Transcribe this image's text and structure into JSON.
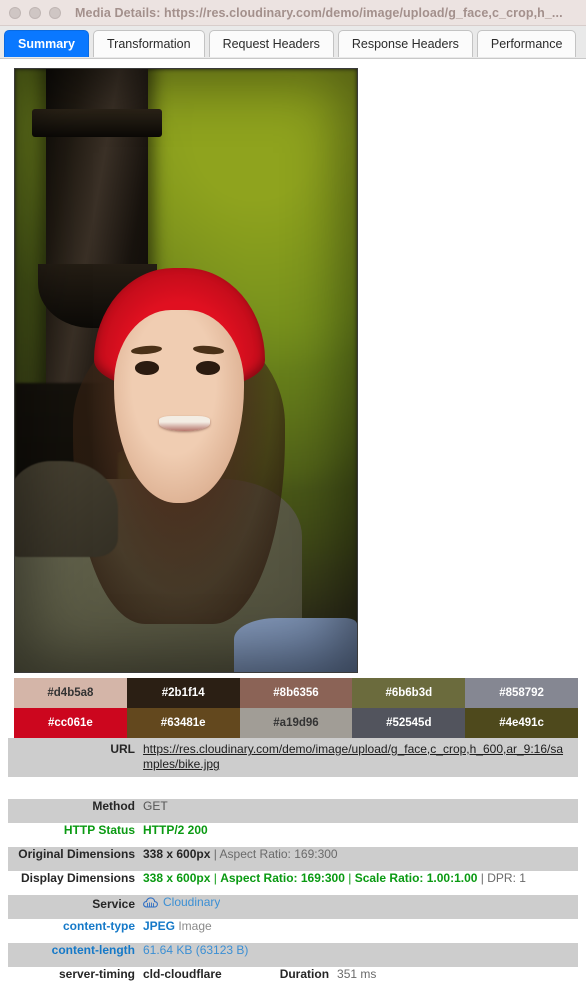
{
  "window": {
    "title": "Media Details: https://res.cloudinary.com/demo/image/upload/g_face,c_crop,h_...",
    "controls": [
      "close",
      "minimize",
      "maximize"
    ]
  },
  "tabs": [
    {
      "label": "Summary",
      "active": true
    },
    {
      "label": "Transformation",
      "active": false
    },
    {
      "label": "Request Headers",
      "active": false
    },
    {
      "label": "Response Headers",
      "active": false
    },
    {
      "label": "Performance",
      "active": false
    }
  ],
  "preview": {
    "alt": "Cropped photo of a smiling young woman wearing a red knit hat, olive jacket, blurred green foliage background"
  },
  "palette": [
    [
      {
        "hex": "#d4b5a8",
        "text": "#d4b5a8",
        "fg": "#333333"
      },
      {
        "hex": "#2b1f14",
        "text": "#2b1f14",
        "fg": "#ffffff"
      },
      {
        "hex": "#8b6356",
        "text": "#8b6356",
        "fg": "#ffffff"
      },
      {
        "hex": "#6b6b3d",
        "text": "#6b6b3d",
        "fg": "#ffffff"
      },
      {
        "hex": "#858792",
        "text": "#858792",
        "fg": "#ffffff"
      }
    ],
    [
      {
        "hex": "#cc061e",
        "text": "#cc061e",
        "fg": "#ffffff"
      },
      {
        "hex": "#63481e",
        "text": "#63481e",
        "fg": "#ffffff"
      },
      {
        "hex": "#a19d96",
        "text": "#a19d96",
        "fg": "#333333"
      },
      {
        "hex": "#52545d",
        "text": "#52545d",
        "fg": "#ffffff"
      },
      {
        "hex": "#4e491c",
        "text": "#4e491c",
        "fg": "#ffffff"
      }
    ]
  ],
  "url": {
    "label": "URL",
    "value": "https://res.cloudinary.com/demo/image/upload/g_face,c_crop,h_600,ar_9:16/samples/bike.jpg"
  },
  "info": {
    "method": {
      "label": "Method",
      "value": "GET"
    },
    "http_status": {
      "label": "HTTP Status",
      "value": "HTTP/2 200"
    },
    "original_dimensions": {
      "label": "Original Dimensions",
      "size": "338 x 600px",
      "sep1": " | ",
      "aspect": "Aspect Ratio: 169:300"
    },
    "display_dimensions": {
      "label": "Display Dimensions",
      "size": "338 x 600px",
      "sep1": " | ",
      "aspect": "Aspect Ratio: 169:300",
      "sep2": " | ",
      "scale": "Scale Ratio: 1.00:1.00",
      "sep3": " | ",
      "dpr": "DPR: 1"
    },
    "service": {
      "label": "Service",
      "value": "Cloudinary",
      "icon": "cloud-icon"
    },
    "content_type": {
      "label": "content-type",
      "format": "JPEG",
      "kind": " Image"
    },
    "content_length": {
      "label": "content-length",
      "value": "61.64 KB (63123 B)"
    },
    "server_timing": {
      "label": "server-timing",
      "value": "cld-cloudflare",
      "duration_label": "Duration",
      "duration_value": "351 ms"
    }
  }
}
